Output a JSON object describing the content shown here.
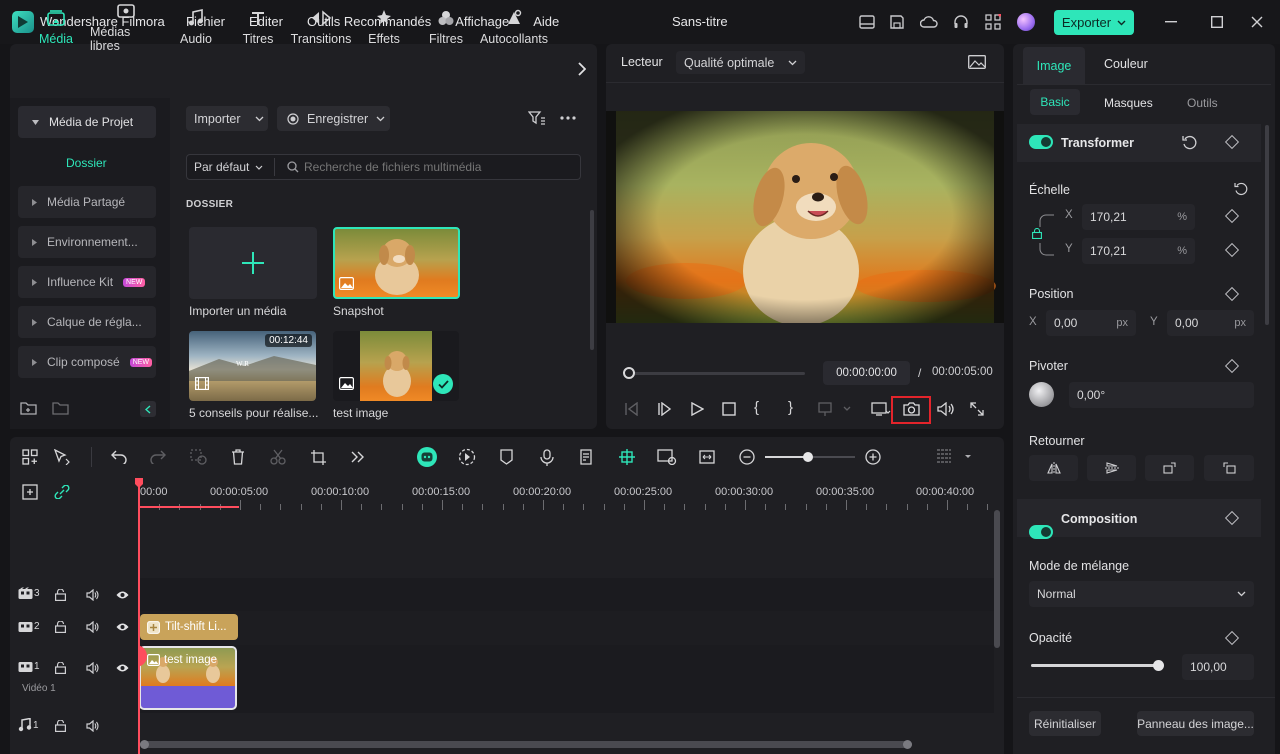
{
  "app": {
    "name": "Wondershare Filmora",
    "doc_title": "Sans-titre",
    "export_label": "Exporter"
  },
  "menu": [
    "Fichier",
    "Editer",
    "Outils Recommandés",
    "Affichage",
    "Aide"
  ],
  "tools": [
    {
      "label": "Média",
      "icon": "media-icon"
    },
    {
      "label": "Médias libres",
      "icon": "stock-media-icon"
    },
    {
      "label": "Audio",
      "icon": "music-note-icon"
    },
    {
      "label": "Titres",
      "icon": "text-icon"
    },
    {
      "label": "Transitions",
      "icon": "transitions-icon"
    },
    {
      "label": "Effets",
      "icon": "effects-icon"
    },
    {
      "label": "Filtres",
      "icon": "filters-icon"
    },
    {
      "label": "Autocollants",
      "icon": "stickers-icon"
    }
  ],
  "sidebar": {
    "project": "Média de Projet",
    "folder": "Dossier",
    "items": [
      "Média Partagé",
      "Environnement...",
      "Influence Kit",
      "Calque de régla...",
      "Clip composé"
    ],
    "new_badge": "NEW"
  },
  "media": {
    "import_label": "Importer",
    "record_label": "Enregistrer",
    "sort_label": "Par défaut",
    "search_placeholder": "Recherche de fichiers multimédia",
    "section": "DOSSIER",
    "tiles": [
      {
        "caption": "Importer un média"
      },
      {
        "caption": "Snapshot"
      },
      {
        "caption": "5 conseils pour réalise...",
        "duration": "00:12:44"
      },
      {
        "caption": "test image"
      }
    ]
  },
  "player": {
    "label": "Lecteur",
    "quality": "Qualité optimale",
    "current_time": "00:00:00:00",
    "separator": "/",
    "total_time": "00:00:05:00"
  },
  "timeline": {
    "ruler": [
      "00:00",
      "00:00:05:00",
      "00:00:10:00",
      "00:00:15:00",
      "00:00:20:00",
      "00:00:25:00",
      "00:00:30:00",
      "00:00:35:00",
      "00:00:40:00"
    ],
    "tracks": [
      {
        "num": "3"
      },
      {
        "num": "2",
        "clip": "Tilt-shift Li..."
      },
      {
        "num": "1",
        "clip": "test image",
        "name": "Vidéo 1"
      },
      {
        "num": "1"
      }
    ]
  },
  "right_panel": {
    "tabs": [
      "Image",
      "Couleur"
    ],
    "subtabs": [
      "Basic",
      "Masques",
      "Outils"
    ],
    "transform": "Transformer",
    "scale": {
      "label": "Échelle",
      "x": "170,21",
      "y": "170,21",
      "unit": "%",
      "x_axis": "X",
      "y_axis": "Y"
    },
    "position": {
      "label": "Position",
      "x": "0,00",
      "y": "0,00",
      "unit": "px",
      "x_axis": "X",
      "y_axis": "Y"
    },
    "rotate": {
      "label": "Pivoter",
      "value": "0,00°"
    },
    "flip": {
      "label": "Retourner"
    },
    "composition": "Composition",
    "blend": {
      "label": "Mode de mélange",
      "value": "Normal"
    },
    "opacity": {
      "label": "Opacité",
      "value": "100,00",
      "level": 1.0
    },
    "reset_label": "Réinitialiser",
    "panel_label": "Panneau des image..."
  },
  "colors": {
    "accent": "#2ee6b9",
    "playhead": "#ff4d5e",
    "video_clip": "#6f5bd6",
    "effect_clip": "#c9a35a",
    "highlight": "#e3242b"
  }
}
